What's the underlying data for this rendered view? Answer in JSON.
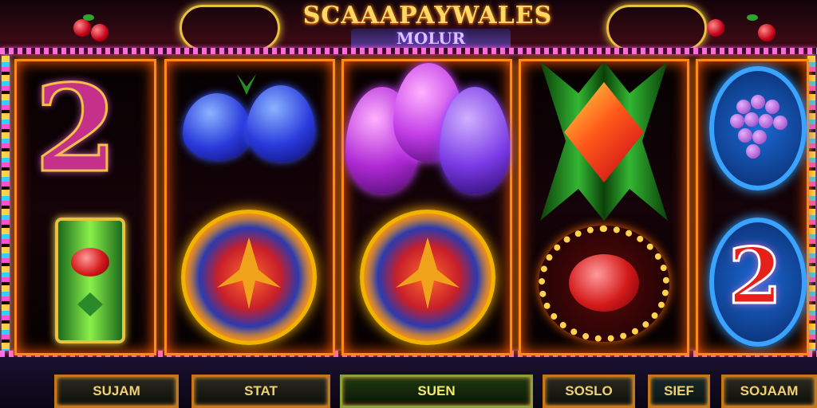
{
  "game": {
    "title": "SCAAAPAYWALES",
    "subtitle": "MOLUR"
  },
  "buttons": [
    {
      "label": "SUJAM"
    },
    {
      "label": "STAT"
    },
    {
      "label": "SUEN"
    },
    {
      "label": "SOSLO"
    },
    {
      "label": "SIEF"
    },
    {
      "label": "SOJAAM"
    }
  ],
  "reels": [
    {
      "symbols": [
        "two-symbol",
        "gem-slot-symbol"
      ]
    },
    {
      "symbols": [
        "plum-symbol",
        "bow-coin-symbol"
      ]
    },
    {
      "symbols": [
        "plum-symbol",
        "bow-coin-symbol"
      ]
    },
    {
      "symbols": [
        "diamond-symbol",
        "ruby-ring-symbol"
      ]
    },
    {
      "symbols": [
        "grapes-symbol",
        "two-symbol"
      ]
    }
  ],
  "symbol_text": {
    "two_a": "2",
    "two_b": "2"
  },
  "colors": {
    "reel_border": "#ff8a1a",
    "lights": "#ff6adf",
    "title": "#ffd866"
  }
}
